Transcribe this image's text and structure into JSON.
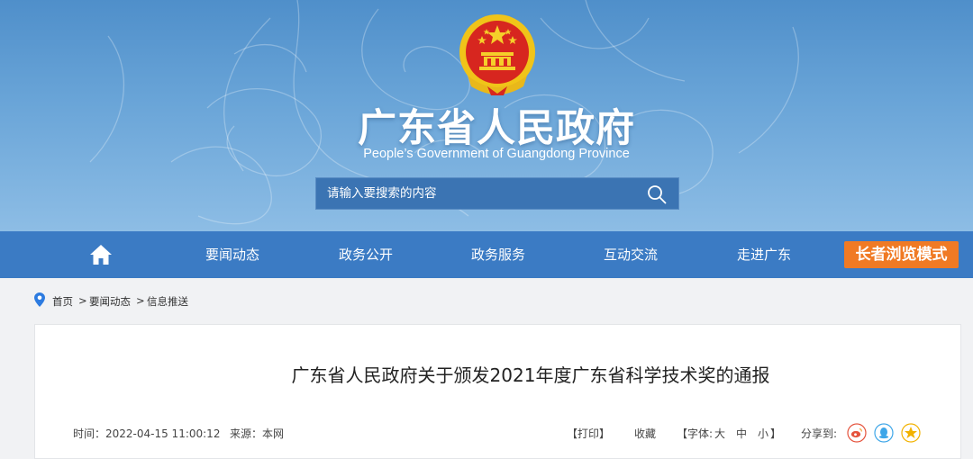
{
  "header": {
    "title": "广东省人民政府",
    "subtitle": "People’s Government of Guangdong Province",
    "emblem": "national-emblem"
  },
  "search": {
    "placeholder": "请输入要搜索的内容",
    "icon": "search-icon"
  },
  "nav": {
    "home_icon": "home-icon",
    "items": [
      "要闻动态",
      "政务公开",
      "政务服务",
      "互动交流",
      "走进广东"
    ],
    "elder_mode": "长者浏览模式"
  },
  "breadcrumb": {
    "icon": "location-pin-icon",
    "items": [
      "首页",
      "要闻动态",
      "信息推送"
    ],
    "separator": ">"
  },
  "article": {
    "title": "广东省人民政府关于颁发2021年度广东省科学技术奖的通报",
    "time": "时间：2022-04-15 11:00:12",
    "source": "来源：本网",
    "print": "【打印】",
    "favorite": "收藏",
    "font_size_label": "【字体:",
    "font_large": "大",
    "font_medium": "中",
    "font_small": "小",
    "font_close": "】",
    "share_label": "分享到:",
    "share_icons": [
      "weibo-icon",
      "qq-icon",
      "qzone-icon"
    ]
  },
  "colors": {
    "nav_bg": "#3b7bc4",
    "elder_btn": "#f07a24",
    "banner_top": "#4f8fca",
    "banner_bottom": "#8dbde5"
  }
}
